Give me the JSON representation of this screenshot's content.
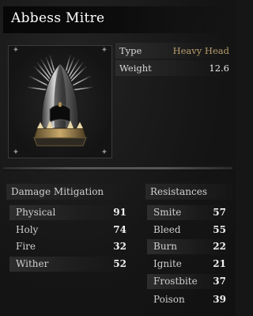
{
  "item": {
    "name": "Abbess Mitre",
    "icon": "helmet-mitre-icon"
  },
  "stats": [
    {
      "label": "Type",
      "value": "Heavy Head"
    },
    {
      "label": "Weight",
      "value": "12.6"
    }
  ],
  "damage_mitigation": {
    "title": "Damage Mitigation",
    "rows": [
      {
        "label": "Physical",
        "value": "91"
      },
      {
        "label": "Holy",
        "value": "74"
      },
      {
        "label": "Fire",
        "value": "32"
      },
      {
        "label": "Wither",
        "value": "52"
      }
    ]
  },
  "resistances": {
    "title": "Resistances",
    "rows": [
      {
        "label": "Smite",
        "value": "57"
      },
      {
        "label": "Bleed",
        "value": "55"
      },
      {
        "label": "Burn",
        "value": "22"
      },
      {
        "label": "Ignite",
        "value": "21"
      },
      {
        "label": "Frostbite",
        "value": "37"
      },
      {
        "label": "Poison",
        "value": "39"
      }
    ]
  },
  "colors": {
    "accent": "#b89d6c",
    "background": "#161616",
    "title_text": "#ffffff"
  }
}
